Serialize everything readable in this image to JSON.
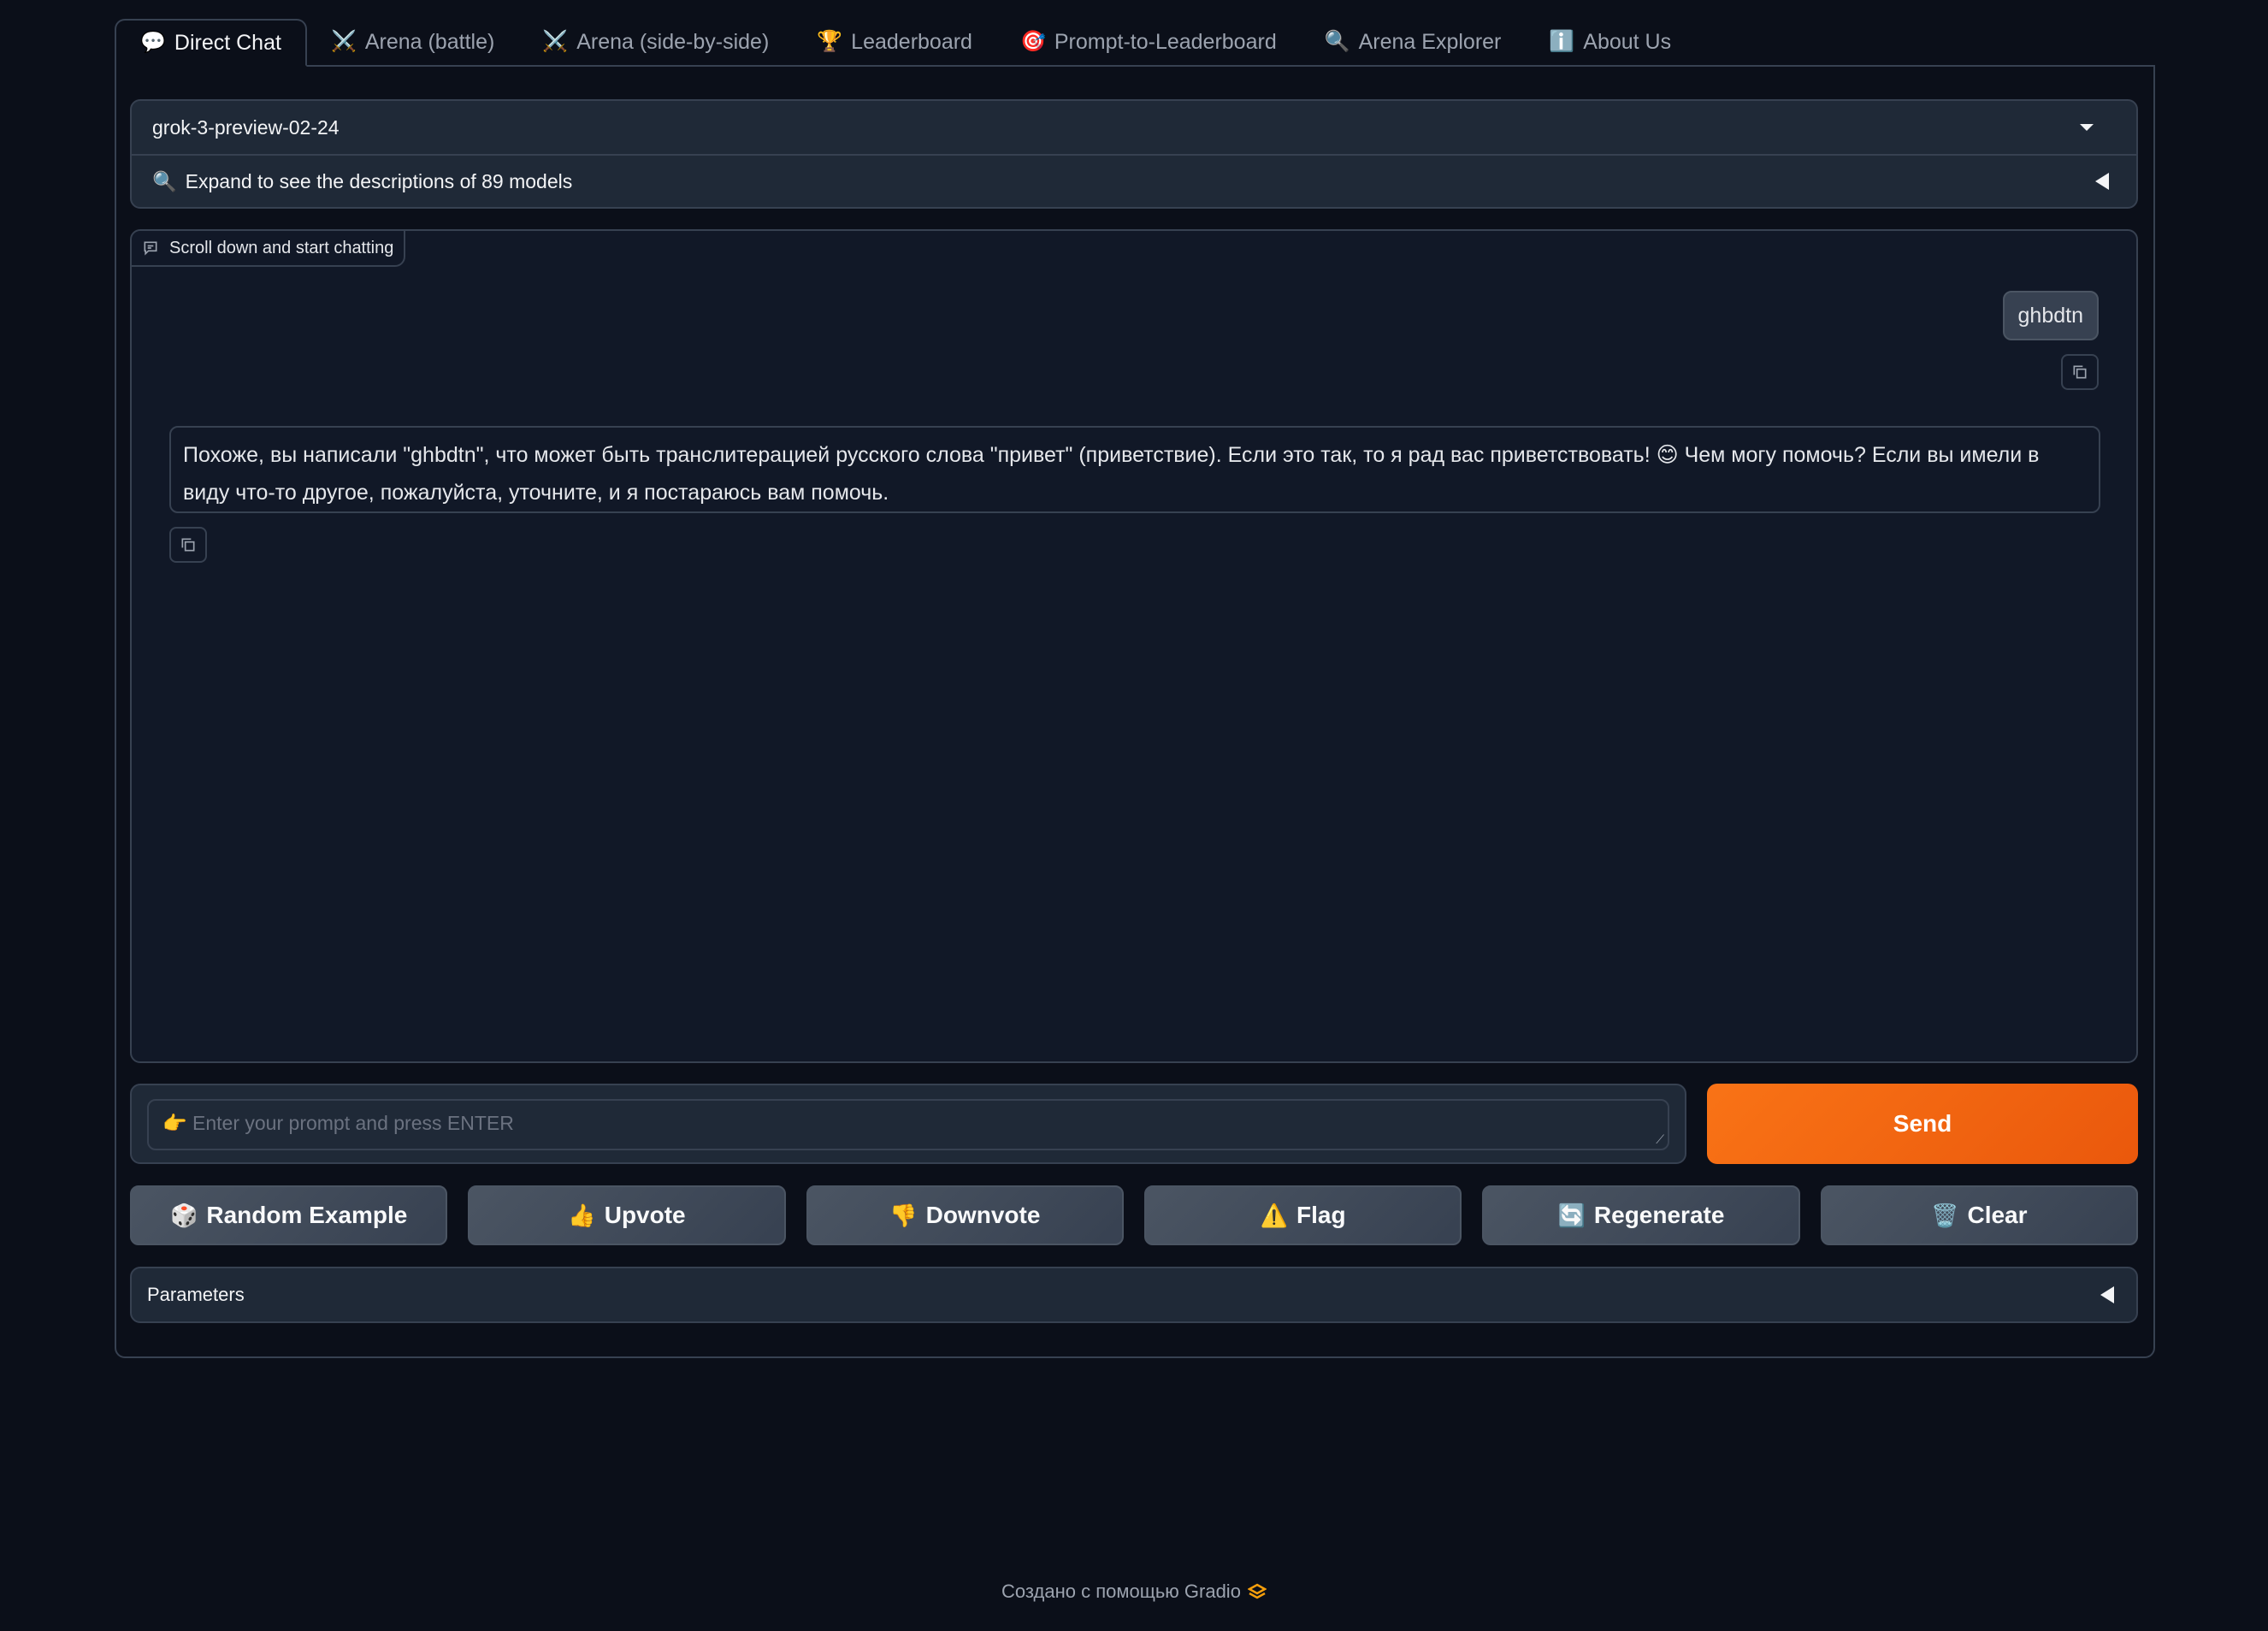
{
  "tabs": [
    {
      "label": "Direct Chat",
      "icon": "💬",
      "icon_name": "speech-bubble-icon",
      "active": true
    },
    {
      "label": "Arena (battle)",
      "icon": "⚔️",
      "icon_name": "crossed-swords-icon",
      "active": false
    },
    {
      "label": "Arena (side-by-side)",
      "icon": "⚔️",
      "icon_name": "crossed-swords-icon",
      "active": false
    },
    {
      "label": "Leaderboard",
      "icon": "🏆",
      "icon_name": "trophy-icon",
      "active": false
    },
    {
      "label": "Prompt-to-Leaderboard",
      "icon": "🎯",
      "icon_name": "target-icon",
      "active": false
    },
    {
      "label": "Arena Explorer",
      "icon": "🔍",
      "icon_name": "magnifier-icon",
      "active": false
    },
    {
      "label": "About Us",
      "icon": "ℹ️",
      "icon_name": "info-icon",
      "active": false
    }
  ],
  "model_selector": {
    "selected": "grok-3-preview-02-24",
    "expand_icon": "🔍",
    "expand_label": "Expand to see the descriptions of 89 models"
  },
  "chatbot": {
    "label": "Scroll down and start chatting",
    "messages": [
      {
        "role": "user",
        "text": "ghbdtn"
      },
      {
        "role": "assistant",
        "text": "Похоже, вы написали \"ghbdtn\", что может быть транслитерацией русского слова \"привет\" (приветствие). Если это так, то я рад вас приветствовать! 😊 Чем могу помочь? Если вы имели в виду что-то другое, пожалуйста, уточните, и я постараюсь вам помочь."
      }
    ]
  },
  "input": {
    "placeholder": "👉 Enter your prompt and press ENTER",
    "value": ""
  },
  "send_button": {
    "label": "Send",
    "color": "#f97316"
  },
  "actions": [
    {
      "label": "Random Example",
      "icon": "🎲",
      "icon_name": "dice-icon"
    },
    {
      "label": "Upvote",
      "icon": "👍",
      "icon_name": "thumbs-up-icon"
    },
    {
      "label": "Downvote",
      "icon": "👎",
      "icon_name": "thumbs-down-icon"
    },
    {
      "label": "Flag",
      "icon": "⚠️",
      "icon_name": "warning-icon"
    },
    {
      "label": "Regenerate",
      "icon": "🔄",
      "icon_name": "refresh-icon"
    },
    {
      "label": "Clear",
      "icon": "🗑️",
      "icon_name": "wastebasket-icon"
    }
  ],
  "parameters": {
    "label": "Parameters"
  },
  "footer": {
    "text": "Создано с помощью Gradio",
    "logo_color": "#f59e0b"
  }
}
